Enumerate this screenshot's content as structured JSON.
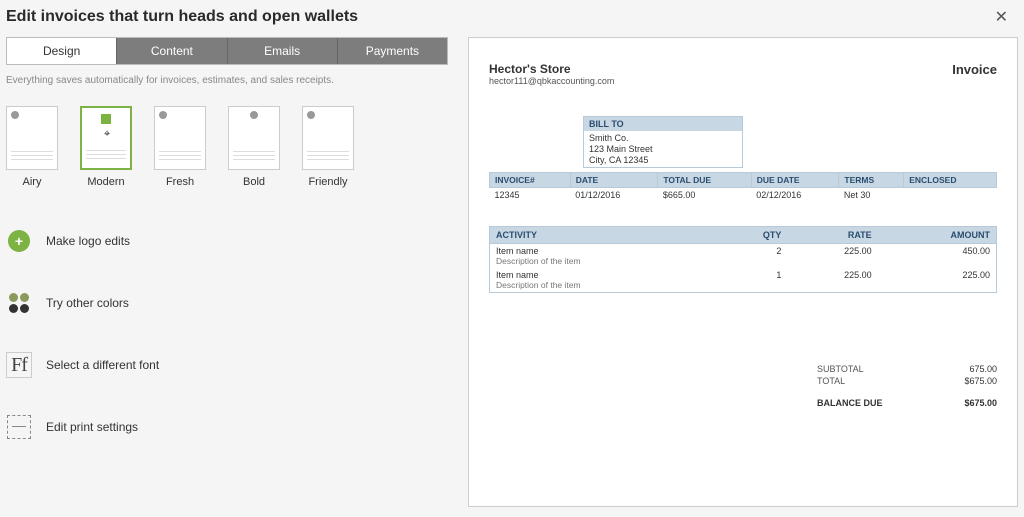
{
  "header": {
    "title": "Edit invoices that turn heads and open wallets"
  },
  "tabs": [
    "Design",
    "Content",
    "Emails",
    "Payments"
  ],
  "autosave_note": "Everything saves automatically for invoices, estimates, and sales receipts.",
  "templates": [
    "Airy",
    "Modern",
    "Fresh",
    "Bold",
    "Friendly"
  ],
  "options": {
    "logo": "Make logo edits",
    "colors": "Try other colors",
    "font": "Select a different font",
    "print": "Edit print settings"
  },
  "invoice": {
    "company": "Hector's Store",
    "email": "hector111@qbkaccounting.com",
    "title": "Invoice",
    "bill_to_label": "BILL TO",
    "bill_to": {
      "name": "Smith Co.",
      "street": "123 Main Street",
      "city": "City, CA 12345"
    },
    "meta_headers": [
      "INVOICE#",
      "DATE",
      "TOTAL DUE",
      "DUE DATE",
      "TERMS",
      "ENCLOSED"
    ],
    "meta_values": [
      "12345",
      "01/12/2016",
      "$665.00",
      "02/12/2016",
      "Net 30",
      ""
    ],
    "item_headers": [
      "ACTIVITY",
      "QTY",
      "RATE",
      "AMOUNT"
    ],
    "items": [
      {
        "name": "Item name",
        "desc": "Description of the item",
        "qty": "2",
        "rate": "225.00",
        "amount": "450.00"
      },
      {
        "name": "Item name",
        "desc": "Description of the item",
        "qty": "1",
        "rate": "225.00",
        "amount": "225.00"
      }
    ],
    "totals": {
      "subtotal_label": "SUBTOTAL",
      "subtotal": "675.00",
      "total_label": "TOTAL",
      "total": "$675.00",
      "balance_label": "BALANCE DUE",
      "balance": "$675.00"
    }
  }
}
